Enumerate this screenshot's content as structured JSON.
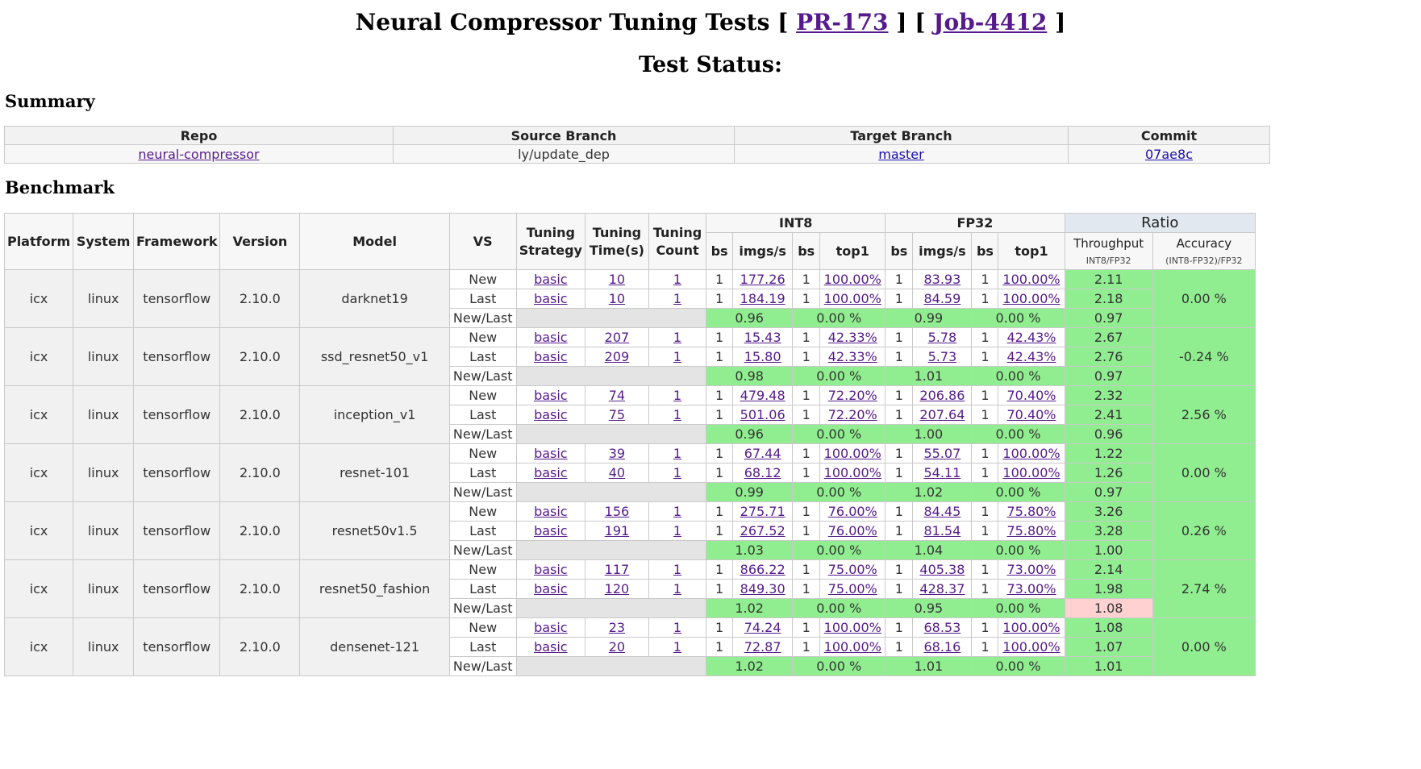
{
  "title": {
    "prefix": "Neural Compressor Tuning Tests [",
    "pr": "PR-173",
    "mid": "] [",
    "job": "Job-4412",
    "suffix": "]"
  },
  "status_heading": "Test Status:",
  "summary": {
    "heading": "Summary",
    "headers": [
      "Repo",
      "Source Branch",
      "Target Branch",
      "Commit"
    ],
    "repo": "neural-compressor",
    "source_branch": "ly/update_dep",
    "target_branch": "master",
    "commit": "07ae8c"
  },
  "benchmark": {
    "heading": "Benchmark",
    "headers": {
      "platform": "Platform",
      "system": "System",
      "framework": "Framework",
      "version": "Version",
      "model": "Model",
      "vs": "VS",
      "tuning_strategy_1": "Tuning",
      "tuning_strategy_2": "Strategy",
      "tuning_time_1": "Tuning",
      "tuning_time_2": "Time(s)",
      "tuning_count_1": "Tuning",
      "tuning_count_2": "Count",
      "int8": "INT8",
      "fp32": "FP32",
      "ratio": "Ratio",
      "bs": "bs",
      "imgs": "imgs/s",
      "top1": "top1",
      "throughput": "Throughput",
      "throughput_sub": "INT8/FP32",
      "accuracy": "Accuracy",
      "accuracy_sub": "(INT8-FP32)/FP32"
    },
    "rows": [
      {
        "platform": "icx",
        "system": "linux",
        "framework": "tensorflow",
        "version": "2.10.0",
        "model": "darknet19",
        "new": {
          "vs": "New",
          "strategy": "basic",
          "time": "10",
          "count": "1",
          "i_bs": "1",
          "i_imgs": "177.26",
          "i_bs2": "1",
          "i_top1": "100.00%",
          "f_bs": "1",
          "f_imgs": "83.93",
          "f_bs2": "1",
          "f_top1": "100.00%",
          "thr": "2.11"
        },
        "last": {
          "vs": "Last",
          "strategy": "basic",
          "time": "10",
          "count": "1",
          "i_bs": "1",
          "i_imgs": "184.19",
          "i_bs2": "1",
          "i_top1": "100.00%",
          "f_bs": "1",
          "f_imgs": "84.59",
          "f_bs2": "1",
          "f_top1": "100.00%",
          "thr": "2.18"
        },
        "nl": {
          "vs": "New/Last",
          "i_imgs": "0.96",
          "i_top1": "0.00 %",
          "f_imgs": "0.99",
          "f_top1": "0.00 %",
          "thr": "0.97"
        },
        "accuracy": "0.00 %"
      },
      {
        "platform": "icx",
        "system": "linux",
        "framework": "tensorflow",
        "version": "2.10.0",
        "model": "ssd_resnet50_v1",
        "new": {
          "vs": "New",
          "strategy": "basic",
          "time": "207",
          "count": "1",
          "i_bs": "1",
          "i_imgs": "15.43",
          "i_bs2": "1",
          "i_top1": "42.33%",
          "f_bs": "1",
          "f_imgs": "5.78",
          "f_bs2": "1",
          "f_top1": "42.43%",
          "thr": "2.67"
        },
        "last": {
          "vs": "Last",
          "strategy": "basic",
          "time": "209",
          "count": "1",
          "i_bs": "1",
          "i_imgs": "15.80",
          "i_bs2": "1",
          "i_top1": "42.33%",
          "f_bs": "1",
          "f_imgs": "5.73",
          "f_bs2": "1",
          "f_top1": "42.43%",
          "thr": "2.76"
        },
        "nl": {
          "vs": "New/Last",
          "i_imgs": "0.98",
          "i_top1": "0.00 %",
          "f_imgs": "1.01",
          "f_top1": "0.00 %",
          "thr": "0.97"
        },
        "accuracy": "-0.24 %"
      },
      {
        "platform": "icx",
        "system": "linux",
        "framework": "tensorflow",
        "version": "2.10.0",
        "model": "inception_v1",
        "new": {
          "vs": "New",
          "strategy": "basic",
          "time": "74",
          "count": "1",
          "i_bs": "1",
          "i_imgs": "479.48",
          "i_bs2": "1",
          "i_top1": "72.20%",
          "f_bs": "1",
          "f_imgs": "206.86",
          "f_bs2": "1",
          "f_top1": "70.40%",
          "thr": "2.32"
        },
        "last": {
          "vs": "Last",
          "strategy": "basic",
          "time": "75",
          "count": "1",
          "i_bs": "1",
          "i_imgs": "501.06",
          "i_bs2": "1",
          "i_top1": "72.20%",
          "f_bs": "1",
          "f_imgs": "207.64",
          "f_bs2": "1",
          "f_top1": "70.40%",
          "thr": "2.41"
        },
        "nl": {
          "vs": "New/Last",
          "i_imgs": "0.96",
          "i_top1": "0.00 %",
          "f_imgs": "1.00",
          "f_top1": "0.00 %",
          "thr": "0.96"
        },
        "accuracy": "2.56 %"
      },
      {
        "platform": "icx",
        "system": "linux",
        "framework": "tensorflow",
        "version": "2.10.0",
        "model": "resnet-101",
        "new": {
          "vs": "New",
          "strategy": "basic",
          "time": "39",
          "count": "1",
          "i_bs": "1",
          "i_imgs": "67.44",
          "i_bs2": "1",
          "i_top1": "100.00%",
          "f_bs": "1",
          "f_imgs": "55.07",
          "f_bs2": "1",
          "f_top1": "100.00%",
          "thr": "1.22"
        },
        "last": {
          "vs": "Last",
          "strategy": "basic",
          "time": "40",
          "count": "1",
          "i_bs": "1",
          "i_imgs": "68.12",
          "i_bs2": "1",
          "i_top1": "100.00%",
          "f_bs": "1",
          "f_imgs": "54.11",
          "f_bs2": "1",
          "f_top1": "100.00%",
          "thr": "1.26"
        },
        "nl": {
          "vs": "New/Last",
          "i_imgs": "0.99",
          "i_top1": "0.00 %",
          "f_imgs": "1.02",
          "f_top1": "0.00 %",
          "thr": "0.97"
        },
        "accuracy": "0.00 %"
      },
      {
        "platform": "icx",
        "system": "linux",
        "framework": "tensorflow",
        "version": "2.10.0",
        "model": "resnet50v1.5",
        "new": {
          "vs": "New",
          "strategy": "basic",
          "time": "156",
          "count": "1",
          "i_bs": "1",
          "i_imgs": "275.71",
          "i_bs2": "1",
          "i_top1": "76.00%",
          "f_bs": "1",
          "f_imgs": "84.45",
          "f_bs2": "1",
          "f_top1": "75.80%",
          "thr": "3.26"
        },
        "last": {
          "vs": "Last",
          "strategy": "basic",
          "time": "191",
          "count": "1",
          "i_bs": "1",
          "i_imgs": "267.52",
          "i_bs2": "1",
          "i_top1": "76.00%",
          "f_bs": "1",
          "f_imgs": "81.54",
          "f_bs2": "1",
          "f_top1": "75.80%",
          "thr": "3.28"
        },
        "nl": {
          "vs": "New/Last",
          "i_imgs": "1.03",
          "i_top1": "0.00 %",
          "f_imgs": "1.04",
          "f_top1": "0.00 %",
          "thr": "1.00"
        },
        "accuracy": "0.26 %"
      },
      {
        "platform": "icx",
        "system": "linux",
        "framework": "tensorflow",
        "version": "2.10.0",
        "model": "resnet50_fashion",
        "new": {
          "vs": "New",
          "strategy": "basic",
          "time": "117",
          "count": "1",
          "i_bs": "1",
          "i_imgs": "866.22",
          "i_bs2": "1",
          "i_top1": "75.00%",
          "f_bs": "1",
          "f_imgs": "405.38",
          "f_bs2": "1",
          "f_top1": "73.00%",
          "thr": "2.14"
        },
        "last": {
          "vs": "Last",
          "strategy": "basic",
          "time": "120",
          "count": "1",
          "i_bs": "1",
          "i_imgs": "849.30",
          "i_bs2": "1",
          "i_top1": "75.00%",
          "f_bs": "1",
          "f_imgs": "428.37",
          "f_bs2": "1",
          "f_top1": "73.00%",
          "thr": "1.98"
        },
        "nl": {
          "vs": "New/Last",
          "i_imgs": "1.02",
          "i_top1": "0.00 %",
          "f_imgs": "0.95",
          "f_top1": "0.00 %",
          "thr": "1.08",
          "thr_color": "#ffd1d1"
        },
        "accuracy": "2.74 %"
      },
      {
        "platform": "icx",
        "system": "linux",
        "framework": "tensorflow",
        "version": "2.10.0",
        "model": "densenet-121",
        "new": {
          "vs": "New",
          "strategy": "basic",
          "time": "23",
          "count": "1",
          "i_bs": "1",
          "i_imgs": "74.24",
          "i_bs2": "1",
          "i_top1": "100.00%",
          "f_bs": "1",
          "f_imgs": "68.53",
          "f_bs2": "1",
          "f_top1": "100.00%",
          "thr": "1.08"
        },
        "last": {
          "vs": "Last",
          "strategy": "basic",
          "time": "20",
          "count": "1",
          "i_bs": "1",
          "i_imgs": "72.87",
          "i_bs2": "1",
          "i_top1": "100.00%",
          "f_bs": "1",
          "f_imgs": "68.16",
          "f_bs2": "1",
          "f_top1": "100.00%",
          "thr": "1.07"
        },
        "nl": {
          "vs": "New/Last",
          "i_imgs": "1.02",
          "i_top1": "0.00 %",
          "f_imgs": "1.01",
          "f_top1": "0.00 %",
          "thr": "1.01"
        },
        "accuracy": "0.00 %"
      }
    ]
  },
  "colors": {
    "good": "#90ee90",
    "bad": "#ffd1d1",
    "link": "#1a0dab",
    "visited": "#551a8b"
  }
}
